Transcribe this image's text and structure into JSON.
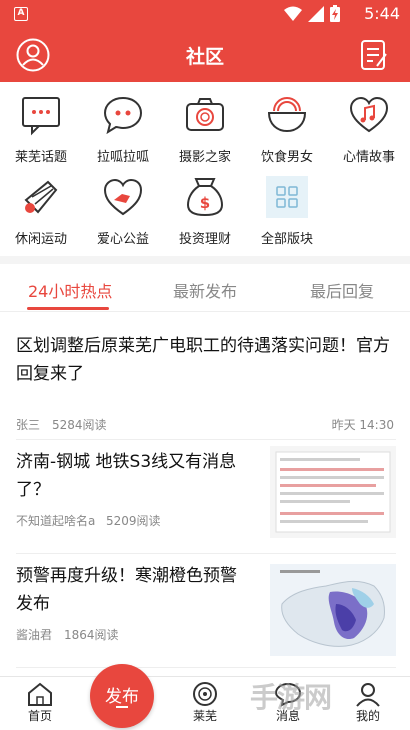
{
  "status": {
    "time": "5:44",
    "app_icon_letter": "A"
  },
  "header": {
    "title": "社区"
  },
  "categories": [
    {
      "label": "莱芜话题",
      "icon": "chat-dots-icon"
    },
    {
      "label": "拉呱拉呱",
      "icon": "speech-bubble-icon"
    },
    {
      "label": "摄影之家",
      "icon": "camera-icon"
    },
    {
      "label": "饮食男女",
      "icon": "food-bowl-icon"
    },
    {
      "label": "心情故事",
      "icon": "heart-music-icon"
    },
    {
      "label": "休闲运动",
      "icon": "badminton-icon"
    },
    {
      "label": "爱心公益",
      "icon": "charity-heart-icon"
    },
    {
      "label": "投资理财",
      "icon": "money-bag-icon"
    },
    {
      "label": "全部版块",
      "icon": "grid-icon"
    }
  ],
  "tabs": [
    "24小时热点",
    "最新发布",
    "最后回复"
  ],
  "posts": [
    {
      "title": "区划调整后原莱芜广电职工的待遇落实问题！官方回复来了",
      "author": "张三",
      "reads": "5284阅读",
      "time": "昨天 14:30"
    },
    {
      "title": "济南-钢城 地铁S3线又有消息了？",
      "author": "不知道起啥名a",
      "reads": "5209阅读"
    },
    {
      "title": "预警再度升级！寒潮橙色预警发布",
      "author": "酱油君",
      "reads": "1864阅读"
    }
  ],
  "bottom_nav": {
    "home": "首页",
    "publish": "发布",
    "laiwu": "莱芜",
    "messages": "消息",
    "mine": "我的"
  },
  "watermark": "手游网",
  "colors": {
    "accent": "#e8473e"
  }
}
